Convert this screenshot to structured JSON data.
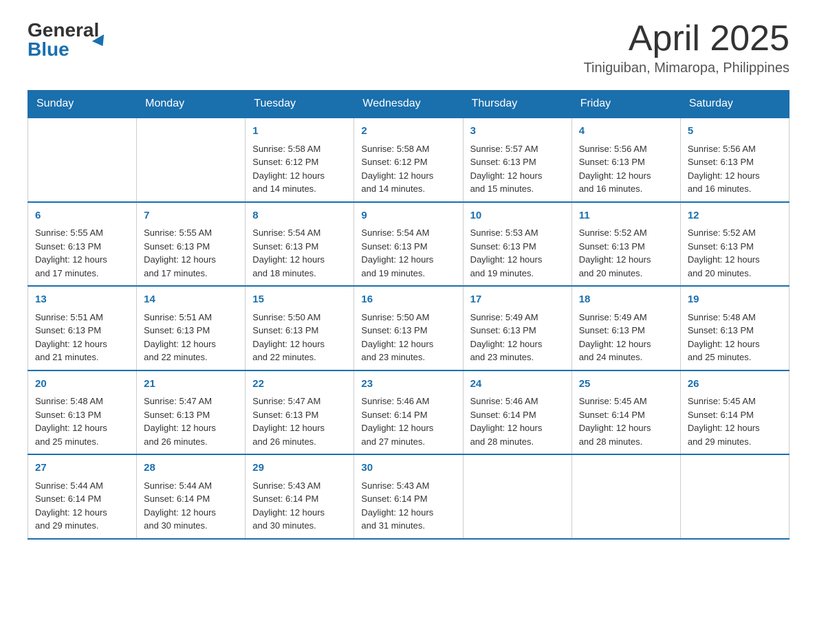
{
  "header": {
    "logo_general": "General",
    "logo_blue": "Blue",
    "title": "April 2025",
    "location": "Tiniguiban, Mimaropa, Philippines"
  },
  "weekdays": [
    "Sunday",
    "Monday",
    "Tuesday",
    "Wednesday",
    "Thursday",
    "Friday",
    "Saturday"
  ],
  "weeks": [
    [
      {
        "day": "",
        "info": ""
      },
      {
        "day": "",
        "info": ""
      },
      {
        "day": "1",
        "info": "Sunrise: 5:58 AM\nSunset: 6:12 PM\nDaylight: 12 hours\nand 14 minutes."
      },
      {
        "day": "2",
        "info": "Sunrise: 5:58 AM\nSunset: 6:12 PM\nDaylight: 12 hours\nand 14 minutes."
      },
      {
        "day": "3",
        "info": "Sunrise: 5:57 AM\nSunset: 6:13 PM\nDaylight: 12 hours\nand 15 minutes."
      },
      {
        "day": "4",
        "info": "Sunrise: 5:56 AM\nSunset: 6:13 PM\nDaylight: 12 hours\nand 16 minutes."
      },
      {
        "day": "5",
        "info": "Sunrise: 5:56 AM\nSunset: 6:13 PM\nDaylight: 12 hours\nand 16 minutes."
      }
    ],
    [
      {
        "day": "6",
        "info": "Sunrise: 5:55 AM\nSunset: 6:13 PM\nDaylight: 12 hours\nand 17 minutes."
      },
      {
        "day": "7",
        "info": "Sunrise: 5:55 AM\nSunset: 6:13 PM\nDaylight: 12 hours\nand 17 minutes."
      },
      {
        "day": "8",
        "info": "Sunrise: 5:54 AM\nSunset: 6:13 PM\nDaylight: 12 hours\nand 18 minutes."
      },
      {
        "day": "9",
        "info": "Sunrise: 5:54 AM\nSunset: 6:13 PM\nDaylight: 12 hours\nand 19 minutes."
      },
      {
        "day": "10",
        "info": "Sunrise: 5:53 AM\nSunset: 6:13 PM\nDaylight: 12 hours\nand 19 minutes."
      },
      {
        "day": "11",
        "info": "Sunrise: 5:52 AM\nSunset: 6:13 PM\nDaylight: 12 hours\nand 20 minutes."
      },
      {
        "day": "12",
        "info": "Sunrise: 5:52 AM\nSunset: 6:13 PM\nDaylight: 12 hours\nand 20 minutes."
      }
    ],
    [
      {
        "day": "13",
        "info": "Sunrise: 5:51 AM\nSunset: 6:13 PM\nDaylight: 12 hours\nand 21 minutes."
      },
      {
        "day": "14",
        "info": "Sunrise: 5:51 AM\nSunset: 6:13 PM\nDaylight: 12 hours\nand 22 minutes."
      },
      {
        "day": "15",
        "info": "Sunrise: 5:50 AM\nSunset: 6:13 PM\nDaylight: 12 hours\nand 22 minutes."
      },
      {
        "day": "16",
        "info": "Sunrise: 5:50 AM\nSunset: 6:13 PM\nDaylight: 12 hours\nand 23 minutes."
      },
      {
        "day": "17",
        "info": "Sunrise: 5:49 AM\nSunset: 6:13 PM\nDaylight: 12 hours\nand 23 minutes."
      },
      {
        "day": "18",
        "info": "Sunrise: 5:49 AM\nSunset: 6:13 PM\nDaylight: 12 hours\nand 24 minutes."
      },
      {
        "day": "19",
        "info": "Sunrise: 5:48 AM\nSunset: 6:13 PM\nDaylight: 12 hours\nand 25 minutes."
      }
    ],
    [
      {
        "day": "20",
        "info": "Sunrise: 5:48 AM\nSunset: 6:13 PM\nDaylight: 12 hours\nand 25 minutes."
      },
      {
        "day": "21",
        "info": "Sunrise: 5:47 AM\nSunset: 6:13 PM\nDaylight: 12 hours\nand 26 minutes."
      },
      {
        "day": "22",
        "info": "Sunrise: 5:47 AM\nSunset: 6:13 PM\nDaylight: 12 hours\nand 26 minutes."
      },
      {
        "day": "23",
        "info": "Sunrise: 5:46 AM\nSunset: 6:14 PM\nDaylight: 12 hours\nand 27 minutes."
      },
      {
        "day": "24",
        "info": "Sunrise: 5:46 AM\nSunset: 6:14 PM\nDaylight: 12 hours\nand 28 minutes."
      },
      {
        "day": "25",
        "info": "Sunrise: 5:45 AM\nSunset: 6:14 PM\nDaylight: 12 hours\nand 28 minutes."
      },
      {
        "day": "26",
        "info": "Sunrise: 5:45 AM\nSunset: 6:14 PM\nDaylight: 12 hours\nand 29 minutes."
      }
    ],
    [
      {
        "day": "27",
        "info": "Sunrise: 5:44 AM\nSunset: 6:14 PM\nDaylight: 12 hours\nand 29 minutes."
      },
      {
        "day": "28",
        "info": "Sunrise: 5:44 AM\nSunset: 6:14 PM\nDaylight: 12 hours\nand 30 minutes."
      },
      {
        "day": "29",
        "info": "Sunrise: 5:43 AM\nSunset: 6:14 PM\nDaylight: 12 hours\nand 30 minutes."
      },
      {
        "day": "30",
        "info": "Sunrise: 5:43 AM\nSunset: 6:14 PM\nDaylight: 12 hours\nand 31 minutes."
      },
      {
        "day": "",
        "info": ""
      },
      {
        "day": "",
        "info": ""
      },
      {
        "day": "",
        "info": ""
      }
    ]
  ]
}
